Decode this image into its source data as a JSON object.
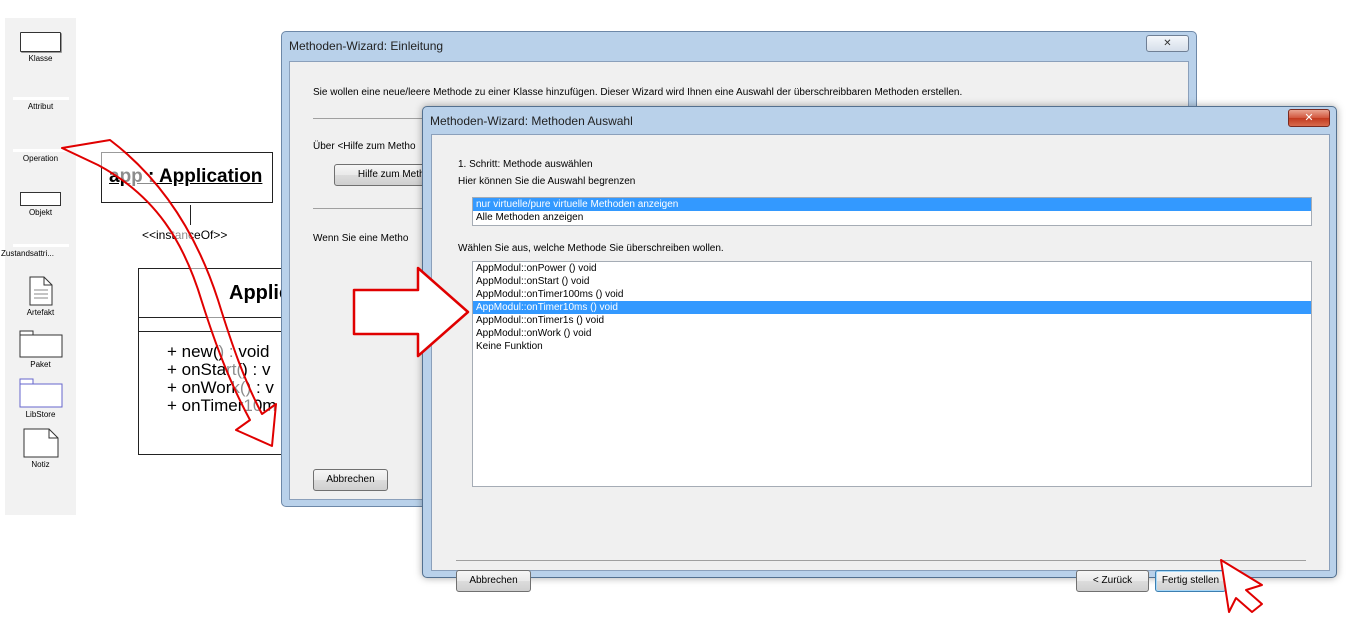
{
  "toolbox": {
    "items": [
      {
        "label": "Klasse",
        "icon": "class-icon"
      },
      {
        "label": "Attribut",
        "icon": "attribute-icon"
      },
      {
        "label": "Operation",
        "icon": "operation-icon"
      },
      {
        "label": "Objekt",
        "icon": "object-icon"
      },
      {
        "label": "Zustandsattri...",
        "icon": "state-attribute-icon"
      },
      {
        "label": "Artefakt",
        "icon": "artifact-icon"
      },
      {
        "label": "Paket",
        "icon": "package-icon"
      },
      {
        "label": "LibStore",
        "icon": "libstore-icon"
      },
      {
        "label": "Notiz",
        "icon": "note-icon"
      }
    ]
  },
  "diagram": {
    "instance_title": "app : Application",
    "stereotype": "<<instanceOf>>",
    "class_name": "Applic",
    "operations": [
      "+ new() : void",
      "+ onStart() : v",
      "+ onWork() : v",
      "+ onTimer10m"
    ]
  },
  "dialog_intro": {
    "title": "Methoden-Wizard: Einleitung",
    "close_label": "✕",
    "intro_text": "Sie wollen eine neue/leere Methode zu einer Klasse hinzufügen. Dieser Wizard wird Ihnen eine Auswahl der überschreibbaren Methoden erstellen.",
    "help_text": "Über <Hilfe zum Metho",
    "help_button": "Hilfe zum Metho",
    "continue_text": "Wenn Sie eine Metho",
    "cancel_button": "Abbrechen"
  },
  "dialog_select": {
    "title": "Methoden-Wizard: Methoden Auswahl",
    "close_label": "✕",
    "step_label": "1. Schritt: Methode auswählen",
    "filter_label": "Hier können Sie die Auswahl begrenzen",
    "filter_options": [
      "nur virtuelle/pure virtuelle Methoden anzeigen",
      "Alle Methoden anzeigen"
    ],
    "filter_selected": "nur virtuelle/pure virtuelle Methoden anzeigen",
    "methods_label": "Wählen Sie aus, welche Methode Sie überschreiben wollen.",
    "methods": [
      "AppModul::onPower () void",
      "AppModul::onStart () void",
      "AppModul::onTimer100ms () void",
      "AppModul::onTimer10ms () void",
      "AppModul::onTimer1s () void",
      "AppModul::onWork () void",
      "Keine Funktion"
    ],
    "method_selected": "AppModul::onTimer10ms () void",
    "cancel_button": "Abbrechen",
    "back_button": "< Zurück",
    "finish_button": "Fertig stellen"
  },
  "colors": {
    "selection": "#3399ff",
    "annotation_arrow": "#e00000",
    "window_frame": "#b9d1ea"
  }
}
